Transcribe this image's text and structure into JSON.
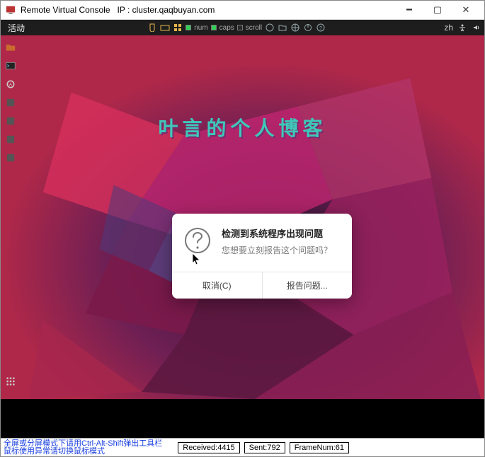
{
  "window": {
    "title": "Remote Virtual Console",
    "ip_label": "IP : cluster.qaqbuyan.com"
  },
  "top_bar": {
    "activities": "活动",
    "indicators": {
      "num": "num",
      "caps": "caps",
      "scroll": "scroll"
    },
    "lang": "zh"
  },
  "blog_title": "叶言的个人博客",
  "dialog": {
    "heading": "检测到系统程序出现问题",
    "sub": "您想要立刻报告这个问题吗？",
    "cancel": "取消(C)",
    "report": "报告问题..."
  },
  "footer": {
    "hint1": "全屏或分屏模式下请用Ctrl-Alt-Shift弹出工具栏",
    "hint2": "鼠标使用异常请切换鼠标模式",
    "received": "Received:4415",
    "sent": "Sent:792",
    "frame": "FrameNum:61"
  }
}
